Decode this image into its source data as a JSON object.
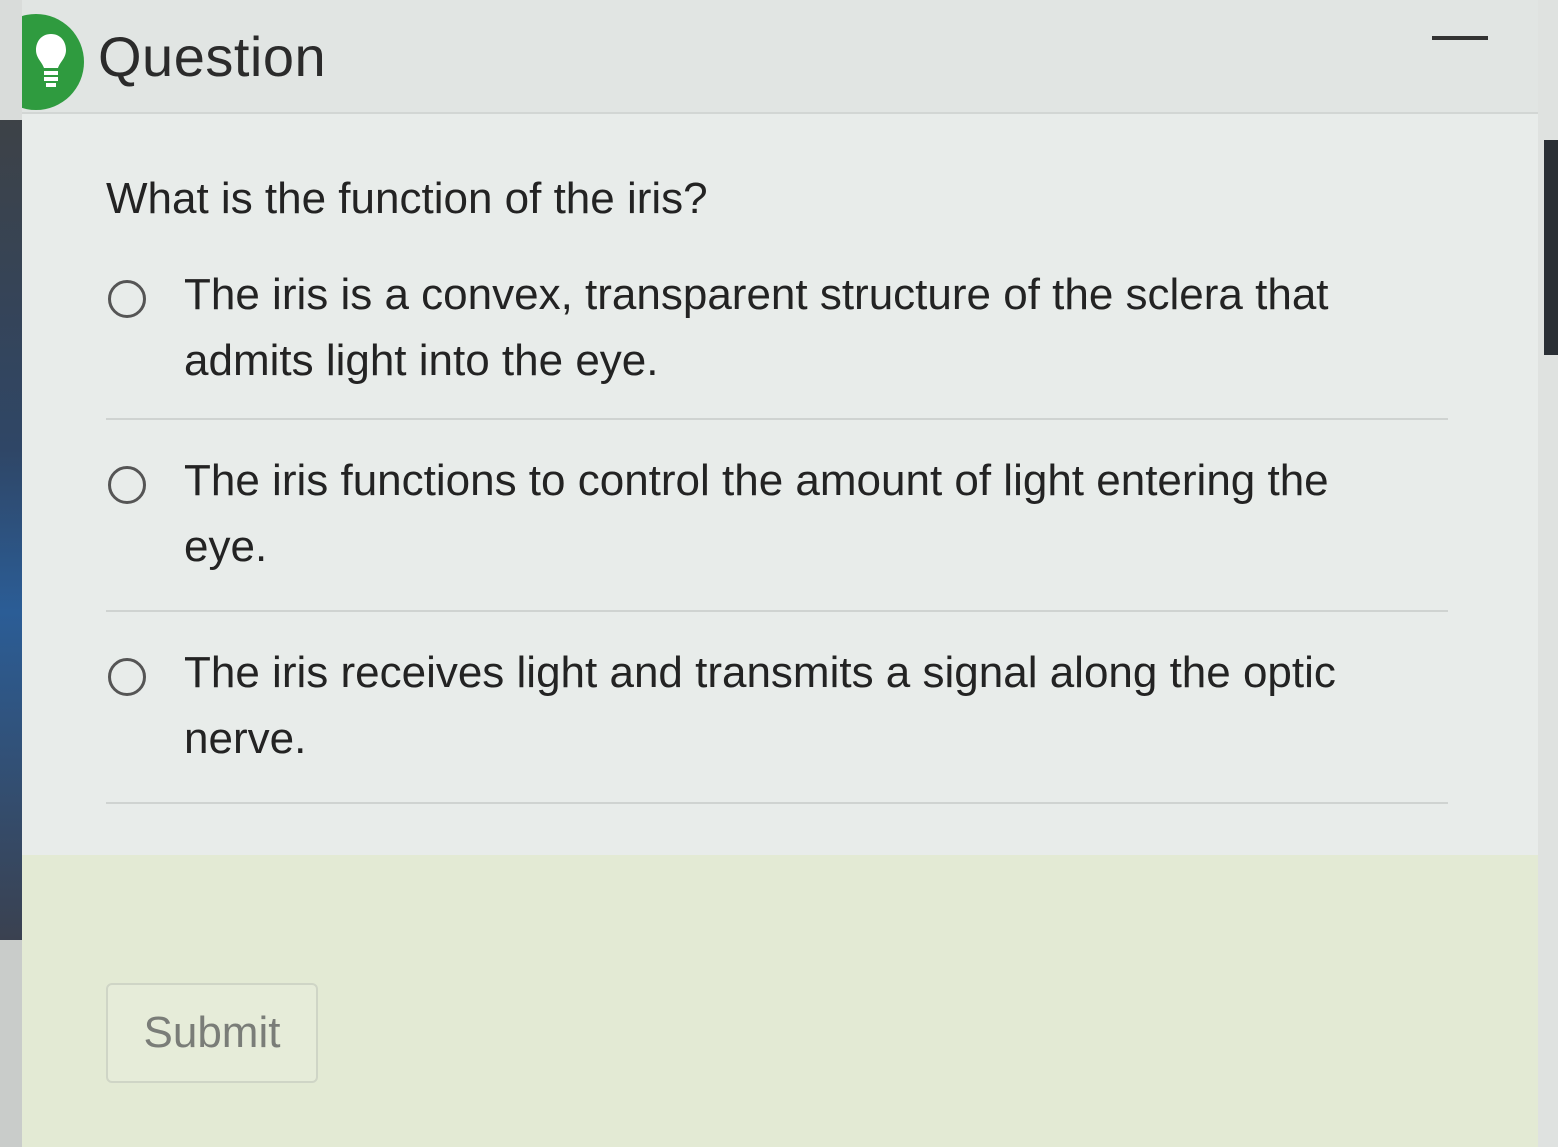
{
  "header": {
    "title": "Question"
  },
  "question": {
    "text": "What is the function of the iris?"
  },
  "options": [
    {
      "label": "The iris is a convex, transparent structure of the sclera that admits light into the eye."
    },
    {
      "label": "The iris functions to control the amount of light entering the eye."
    },
    {
      "label": "The iris receives light and transmits a signal along the optic nerve."
    }
  ],
  "footer": {
    "submit_label": "Submit"
  },
  "colors": {
    "hint_badge": "#2f9b3f",
    "footer_bg": "#e3ead4"
  }
}
